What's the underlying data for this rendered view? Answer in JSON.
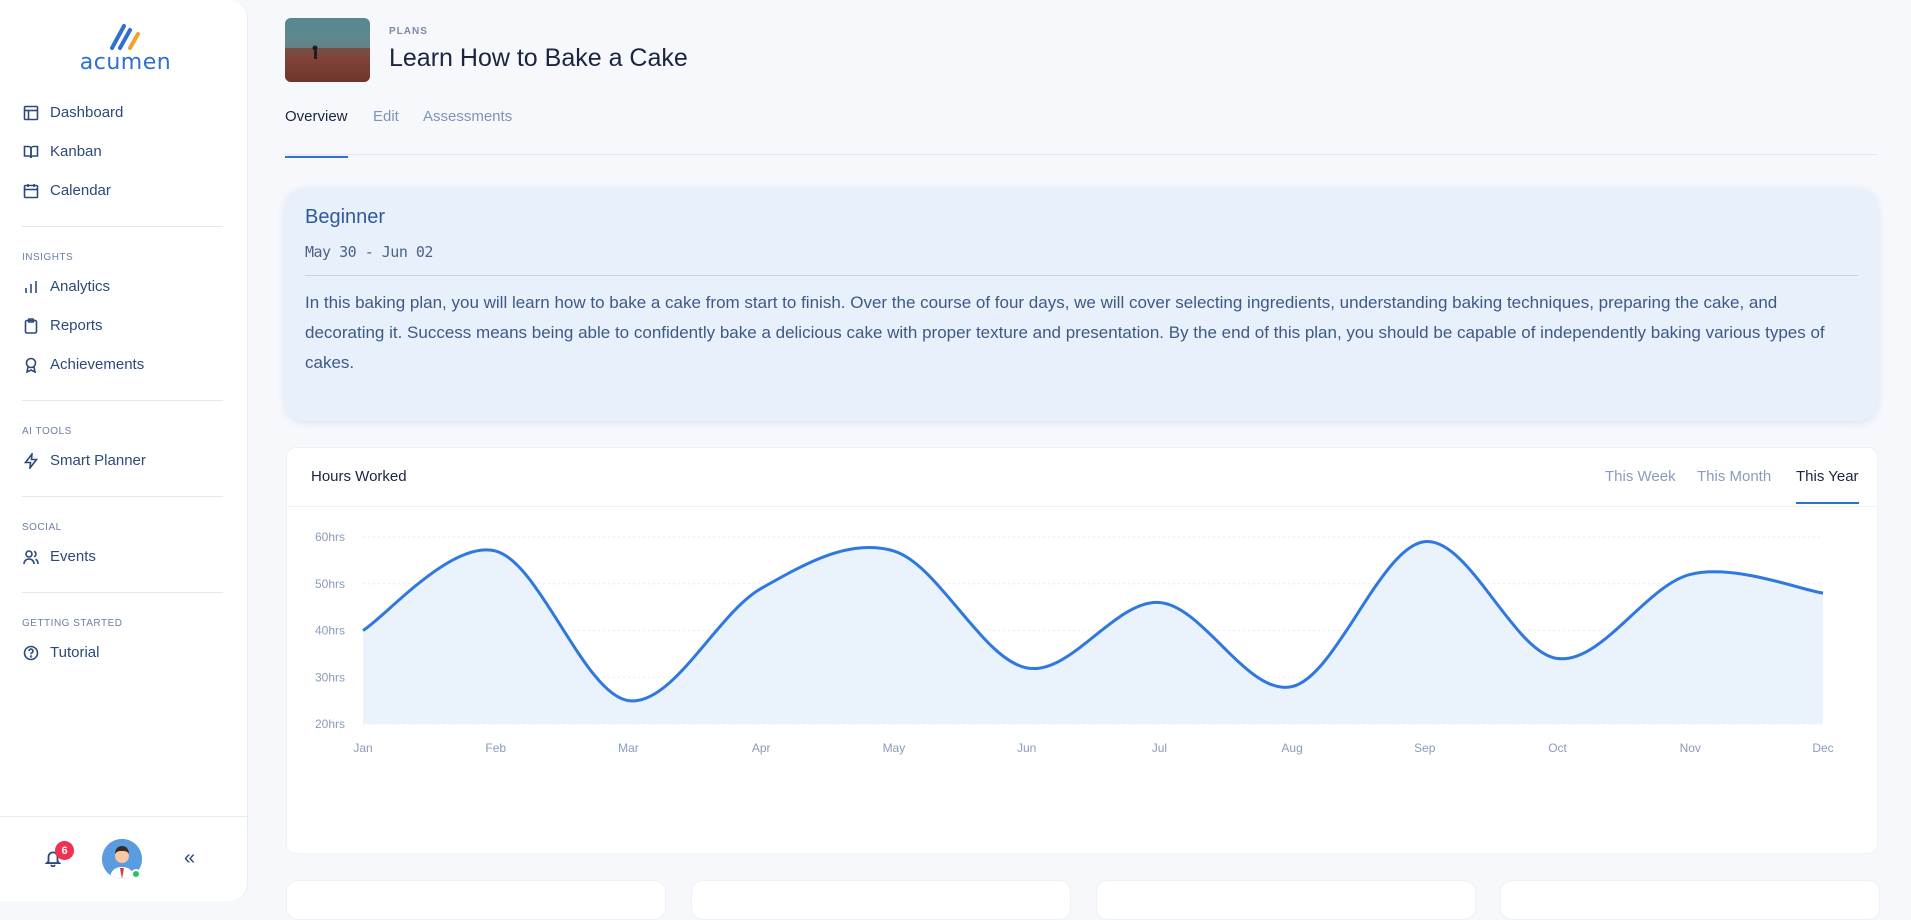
{
  "app": {
    "name": "acumen"
  },
  "sidebar": {
    "primary": [
      {
        "label": "Dashboard",
        "icon": "dashboard-icon"
      },
      {
        "label": "Kanban",
        "icon": "book-icon"
      },
      {
        "label": "Calendar",
        "icon": "calendar-icon"
      }
    ],
    "sections": [
      {
        "title": "INSIGHTS",
        "items": [
          {
            "label": "Analytics",
            "icon": "bar-chart-icon"
          },
          {
            "label": "Reports",
            "icon": "clipboard-icon"
          },
          {
            "label": "Achievements",
            "icon": "award-icon"
          }
        ]
      },
      {
        "title": "AI TOOLS",
        "items": [
          {
            "label": "Smart Planner",
            "icon": "lightning-icon"
          }
        ]
      },
      {
        "title": "SOCIAL",
        "items": [
          {
            "label": "Events",
            "icon": "users-icon"
          }
        ]
      },
      {
        "title": "GETTING STARTED",
        "items": [
          {
            "label": "Tutorial",
            "icon": "help-circle-icon"
          }
        ]
      }
    ],
    "notifications_count": "6",
    "collapse_label": "«"
  },
  "header": {
    "eyebrow": "PLANS",
    "title": "Learn How to Bake a Cake",
    "tabs": [
      "Overview",
      "Edit",
      "Assessments"
    ]
  },
  "summary": {
    "level": "Beginner",
    "dates": "May 30 - Jun 02",
    "description": "In this baking plan, you will learn how to bake a cake from start to finish. Over the course of four days, we will cover selecting ingredients, understanding baking techniques, preparing the cake, and decorating it. Success means being able to confidently bake a delicious cake with proper texture and presentation. By the end of this plan, you should be capable of independently baking various types of cakes."
  },
  "chart_card": {
    "title": "Hours Worked",
    "ranges": [
      "This Week",
      "This Month",
      "This Year"
    ],
    "active_range": "This Year"
  },
  "chart_data": {
    "type": "area",
    "title": "Hours Worked",
    "categories": [
      "Jan",
      "Feb",
      "Mar",
      "Apr",
      "May",
      "Jun",
      "Jul",
      "Aug",
      "Sep",
      "Oct",
      "Nov",
      "Dec"
    ],
    "y_ticks": [
      "60hrs",
      "50hrs",
      "40hrs",
      "30hrs",
      "20hrs"
    ],
    "ylim": [
      20,
      60
    ],
    "series": [
      {
        "values": [
          40,
          57,
          25,
          49,
          57,
          32,
          46,
          28,
          59,
          34,
          52,
          48
        ]
      }
    ],
    "grid": true,
    "colors": {
      "line": "#2f78e0",
      "fill": "#eaf2fc"
    }
  }
}
